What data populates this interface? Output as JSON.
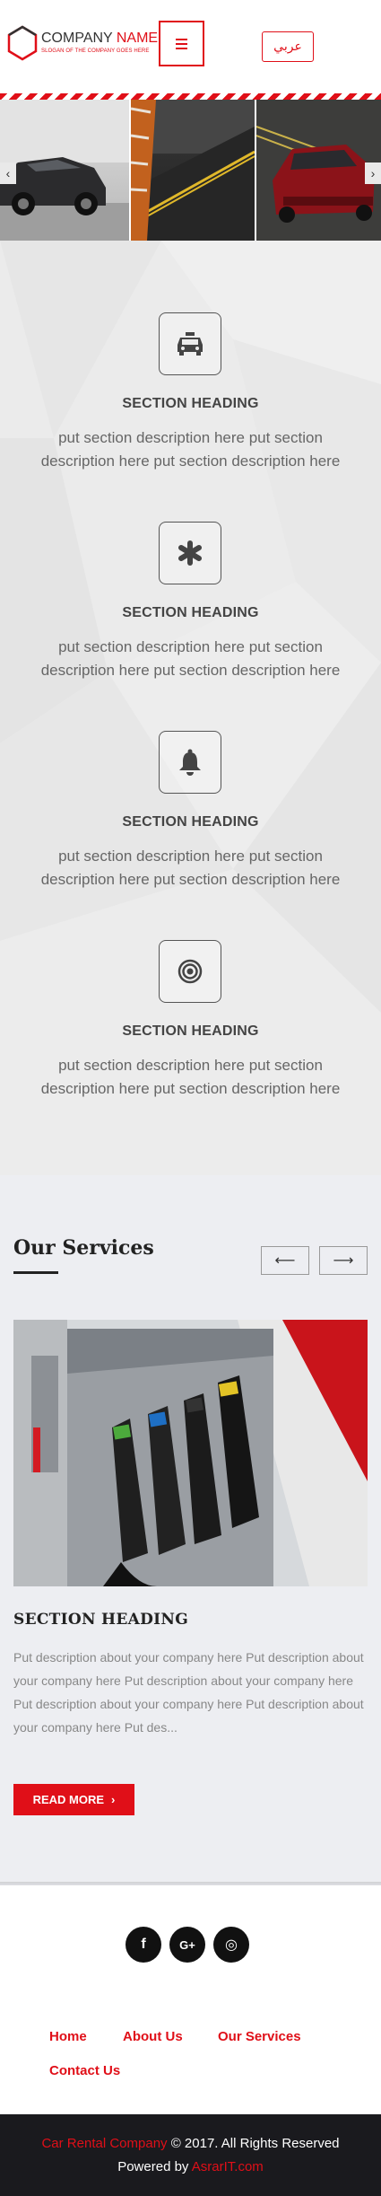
{
  "header": {
    "company_name_part1": "COMPANY ",
    "company_name_part2": "NAME",
    "slogan": "SLOGAN OF THE COMPANY GOES HERE",
    "language_label": "عربي",
    "menu_icon": "hamburger-icon"
  },
  "slider": {
    "prev_icon": "chevron-left-icon",
    "next_icon": "chevron-right-icon"
  },
  "features": [
    {
      "icon": "taxi-icon",
      "title": "SECTION HEADING",
      "description": "put section description here put section description here put section description here"
    },
    {
      "icon": "asterisk-icon",
      "title": "SECTION HEADING",
      "description": "put section description here put section description here put section description here"
    },
    {
      "icon": "bell-icon",
      "title": "SECTION HEADING",
      "description": "put section description here put section description here put section description here"
    },
    {
      "icon": "target-icon",
      "title": "SECTION HEADING",
      "description": "put section description here put section description here put section description here"
    }
  ],
  "services": {
    "title": "Our Services",
    "prev_icon": "arrow-left-icon",
    "next_icon": "arrow-right-icon",
    "card": {
      "title": "SECTION HEADING",
      "description": "Put description about your company here Put description about your company here Put description about your company here Put description about your company here Put description about your company here Put des...",
      "button_label": "READ MORE"
    }
  },
  "footer": {
    "social": [
      "facebook-icon",
      "google-plus-icon",
      "instagram-icon"
    ],
    "social_glyphs": {
      "facebook": "f",
      "google_plus": "G+",
      "instagram": "◎"
    },
    "links": [
      "Home",
      "About Us",
      "Our Services",
      "Contact Us"
    ],
    "copyright_company": "Car Rental Company",
    "copyright_text": " © 2017. All Rights Reserved",
    "powered_prefix": "Powered by ",
    "powered_link": "AsrarIT.com"
  },
  "colors": {
    "accent": "#e00f18",
    "dark": "#1a1a1e",
    "features_bg": "#ebebeb",
    "services_bg": "#edeef2"
  }
}
